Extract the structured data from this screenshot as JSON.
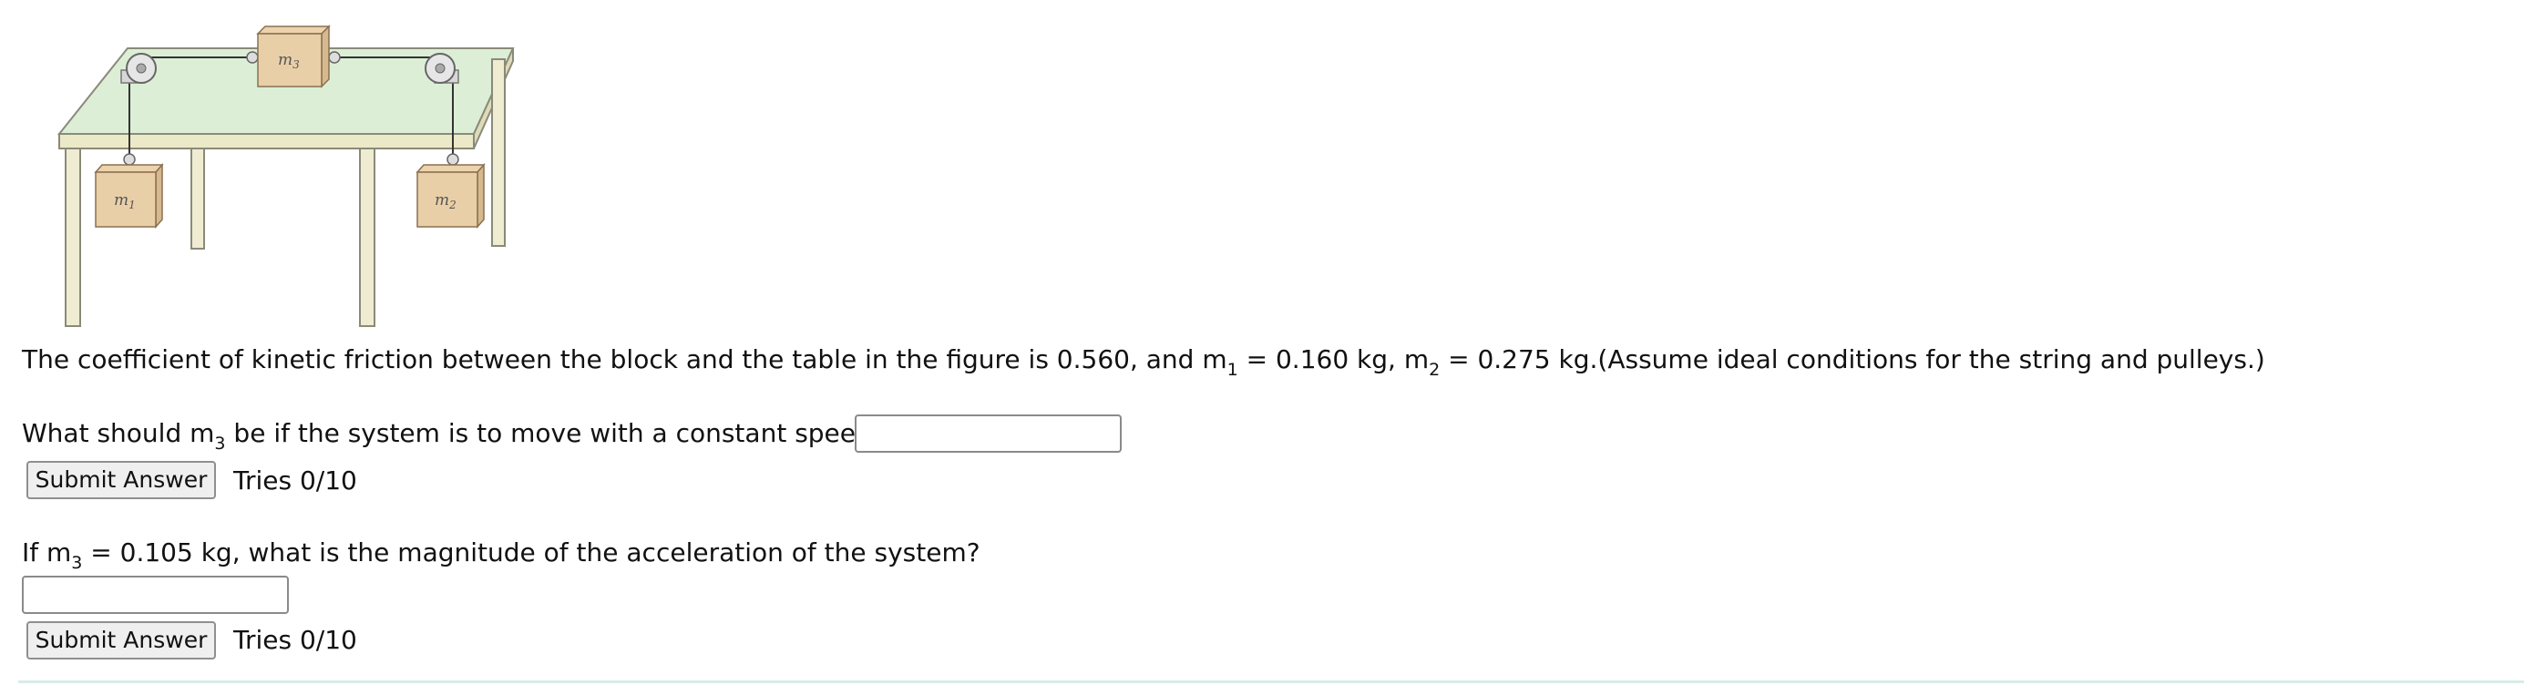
{
  "figure": {
    "block_labels": {
      "m1": "m",
      "m1_sub": "1",
      "m2": "m",
      "m2_sub": "2",
      "m3": "m",
      "m3_sub": "3"
    }
  },
  "problem": {
    "statement": {
      "part1": "The coefficient of kinetic friction between the block and the table in the figure is 0.560, and m",
      "sub1": "1",
      "part2": " = 0.160 kg, m",
      "sub2": "2",
      "part3": " = 0.275 kg.(Assume ideal conditions for the string and pulleys.)"
    }
  },
  "question1": {
    "prefix": "What should m",
    "sub": "3",
    "suffix": " be if the system is to move with a constant speed?",
    "input_value": "",
    "submit_label": "Submit Answer",
    "tries": "Tries 0/10"
  },
  "question2": {
    "prefix": "If m",
    "sub": "3",
    "suffix": " = 0.105 kg, what is the magnitude of the acceleration of the system?",
    "input_value": "",
    "submit_label": "Submit Answer",
    "tries": "Tries 0/10"
  }
}
